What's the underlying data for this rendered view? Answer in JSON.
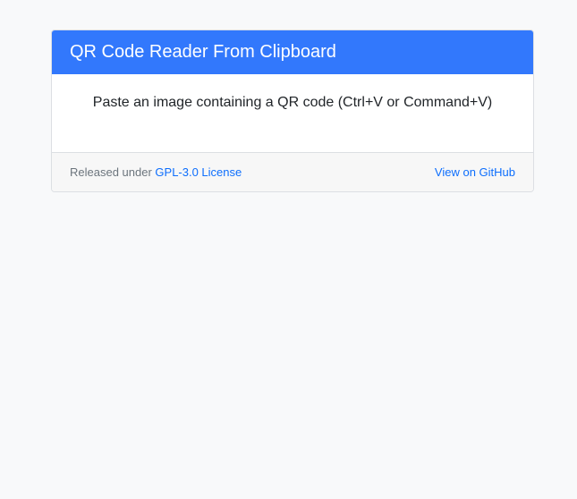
{
  "header": {
    "title": "QR Code Reader From Clipboard"
  },
  "main": {
    "instruction": "Paste an image containing a QR code (Ctrl+V or Command+V)"
  },
  "footer": {
    "released_prefix": "Released under ",
    "license_link": "GPL-3.0 License",
    "github_link": "View on GitHub"
  },
  "colors": {
    "page_background": "#f8f9fa",
    "header_background": "#3278fc",
    "link": "#0d6efd",
    "footer_background": "#f7f7f7"
  }
}
